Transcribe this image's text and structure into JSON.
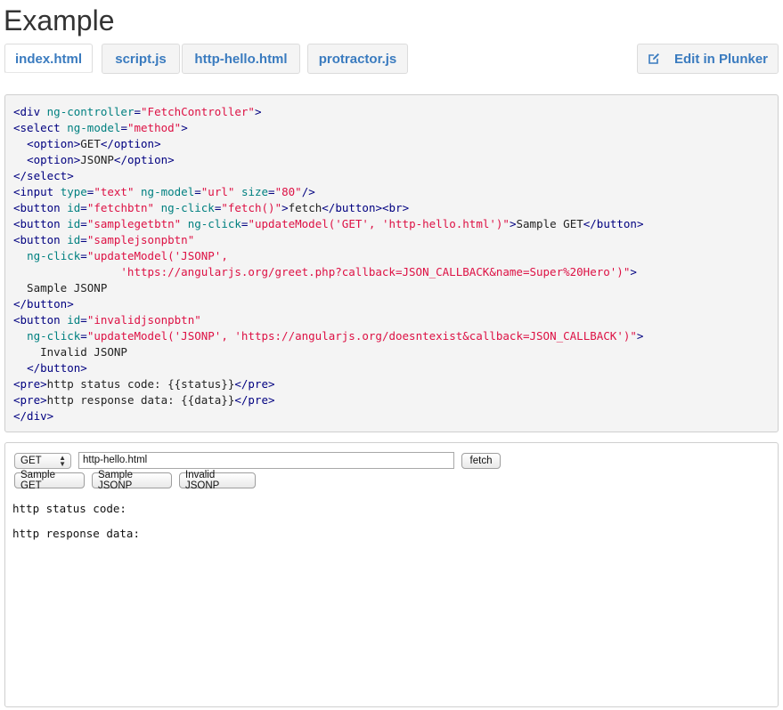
{
  "page": {
    "title": "Example"
  },
  "tabs": [
    {
      "label": "index.html",
      "active": true
    },
    {
      "label": "script.js",
      "active": false
    },
    {
      "label": "http-hello.html",
      "active": false
    },
    {
      "label": "protractor.js",
      "active": false
    }
  ],
  "edit_button": {
    "label": "Edit in Plunker",
    "icon": "edit-icon"
  },
  "code_lines": [
    [
      {
        "t": "tg",
        "v": "<div "
      },
      {
        "t": "at",
        "v": "ng-controller"
      },
      {
        "t": "tg",
        "v": "="
      },
      {
        "t": "st",
        "v": "\"FetchController\""
      },
      {
        "t": "tg",
        "v": ">"
      }
    ],
    [
      {
        "t": "tg",
        "v": "<select "
      },
      {
        "t": "at",
        "v": "ng-model"
      },
      {
        "t": "tg",
        "v": "="
      },
      {
        "t": "st",
        "v": "\"method\""
      },
      {
        "t": "tg",
        "v": ">"
      }
    ],
    [
      {
        "t": "tx",
        "v": "  "
      },
      {
        "t": "tg",
        "v": "<option>"
      },
      {
        "t": "tx",
        "v": "GET"
      },
      {
        "t": "tg",
        "v": "</option>"
      }
    ],
    [
      {
        "t": "tx",
        "v": "  "
      },
      {
        "t": "tg",
        "v": "<option>"
      },
      {
        "t": "tx",
        "v": "JSONP"
      },
      {
        "t": "tg",
        "v": "</option>"
      }
    ],
    [
      {
        "t": "tg",
        "v": "</select>"
      }
    ],
    [
      {
        "t": "tg",
        "v": "<input "
      },
      {
        "t": "at",
        "v": "type"
      },
      {
        "t": "tg",
        "v": "="
      },
      {
        "t": "st",
        "v": "\"text\""
      },
      {
        "t": "tx",
        "v": " "
      },
      {
        "t": "at",
        "v": "ng-model"
      },
      {
        "t": "tg",
        "v": "="
      },
      {
        "t": "st",
        "v": "\"url\""
      },
      {
        "t": "tx",
        "v": " "
      },
      {
        "t": "at",
        "v": "size"
      },
      {
        "t": "tg",
        "v": "="
      },
      {
        "t": "st",
        "v": "\"80\""
      },
      {
        "t": "tg",
        "v": "/>"
      }
    ],
    [
      {
        "t": "tg",
        "v": "<button "
      },
      {
        "t": "at",
        "v": "id"
      },
      {
        "t": "tg",
        "v": "="
      },
      {
        "t": "st",
        "v": "\"fetchbtn\""
      },
      {
        "t": "tx",
        "v": " "
      },
      {
        "t": "at",
        "v": "ng-click"
      },
      {
        "t": "tg",
        "v": "="
      },
      {
        "t": "st",
        "v": "\"fetch()\""
      },
      {
        "t": "tg",
        "v": ">"
      },
      {
        "t": "tx",
        "v": "fetch"
      },
      {
        "t": "tg",
        "v": "</button><br>"
      }
    ],
    [
      {
        "t": "tg",
        "v": "<button "
      },
      {
        "t": "at",
        "v": "id"
      },
      {
        "t": "tg",
        "v": "="
      },
      {
        "t": "st",
        "v": "\"samplegetbtn\""
      },
      {
        "t": "tx",
        "v": " "
      },
      {
        "t": "at",
        "v": "ng-click"
      },
      {
        "t": "tg",
        "v": "="
      },
      {
        "t": "st",
        "v": "\"updateModel('GET', 'http-hello.html')\""
      },
      {
        "t": "tg",
        "v": ">"
      },
      {
        "t": "tx",
        "v": "Sample GET"
      },
      {
        "t": "tg",
        "v": "</button>"
      }
    ],
    [
      {
        "t": "tg",
        "v": "<button "
      },
      {
        "t": "at",
        "v": "id"
      },
      {
        "t": "tg",
        "v": "="
      },
      {
        "t": "st",
        "v": "\"samplejsonpbtn\""
      }
    ],
    [
      {
        "t": "tx",
        "v": "  "
      },
      {
        "t": "at",
        "v": "ng-click"
      },
      {
        "t": "tg",
        "v": "="
      },
      {
        "t": "st",
        "v": "\"updateModel('JSONP',"
      }
    ],
    [
      {
        "t": "st",
        "v": "                'https://angularjs.org/greet.php?callback=JSON_CALLBACK&name=Super%20Hero')\""
      },
      {
        "t": "tg",
        "v": ">"
      }
    ],
    [
      {
        "t": "tx",
        "v": "  Sample JSONP"
      }
    ],
    [
      {
        "t": "tg",
        "v": "</button>"
      }
    ],
    [
      {
        "t": "tg",
        "v": "<button "
      },
      {
        "t": "at",
        "v": "id"
      },
      {
        "t": "tg",
        "v": "="
      },
      {
        "t": "st",
        "v": "\"invalidjsonpbtn\""
      }
    ],
    [
      {
        "t": "tx",
        "v": "  "
      },
      {
        "t": "at",
        "v": "ng-click"
      },
      {
        "t": "tg",
        "v": "="
      },
      {
        "t": "st",
        "v": "\"updateModel('JSONP', 'https://angularjs.org/doesntexist&callback=JSON_CALLBACK')\""
      },
      {
        "t": "tg",
        "v": ">"
      }
    ],
    [
      {
        "t": "tx",
        "v": "    Invalid JSONP"
      }
    ],
    [
      {
        "t": "tx",
        "v": "  "
      },
      {
        "t": "tg",
        "v": "</button>"
      }
    ],
    [
      {
        "t": "tg",
        "v": "<pre>"
      },
      {
        "t": "tx",
        "v": "http status code: {{status}}"
      },
      {
        "t": "tg",
        "v": "</pre>"
      }
    ],
    [
      {
        "t": "tg",
        "v": "<pre>"
      },
      {
        "t": "tx",
        "v": "http response data: {{data}}"
      },
      {
        "t": "tg",
        "v": "</pre>"
      }
    ],
    [
      {
        "t": "tg",
        "v": "</div>"
      }
    ]
  ],
  "demo": {
    "method_select": {
      "selected": "GET"
    },
    "url_input": {
      "value": "http-hello.html"
    },
    "fetch_label": "fetch",
    "sample_get_label": "Sample GET",
    "sample_jsonp_label": "Sample JSONP",
    "invalid_jsonp_label": "Invalid JSONP",
    "status_text": "http status code:",
    "response_text": "http response data:"
  },
  "colors": {
    "tab_text": "#3a7bbf",
    "code_tag": "#000080",
    "code_attr": "#008080",
    "code_string": "#dd1144"
  }
}
